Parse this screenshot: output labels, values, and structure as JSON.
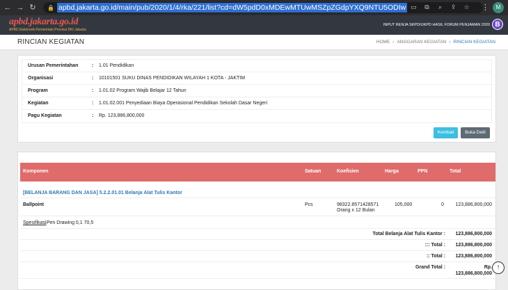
{
  "browser": {
    "url": "apbd.jakarta.go.id/main/pub/2020/1/4/rka/221/list?cd=dW5pdD0xMDEwMTUwMSZpZGdpYXQ9NTU5ODIw",
    "profile_initial": "M"
  },
  "header": {
    "logo": "apbd.jakarta.go.id",
    "logo_subtitle": "APBD Elektronik Pemerintah Provinsi DKI Jakarta",
    "right_text": "INPUT RENJA SKPD/UKPD HASIL FORUM PENJAMAN 2020",
    "badge": "B"
  },
  "page": {
    "title": "RINCIAN KEGIATAN",
    "breadcrumb": [
      "HOME",
      "ANGGARAN KEGIATAN",
      "RINCIAN KEGIATAN"
    ],
    "breadcrumb_sep": "›"
  },
  "info": {
    "rows": [
      {
        "label": "Urusan Pemerintahan",
        "value": "1.01 Pendidikan"
      },
      {
        "label": "Organisasi",
        "value": "10101501 SUKU DINAS PENDIDIKAN WILAYAH 1 KOTA - JAKTIM"
      },
      {
        "label": "Program",
        "value": "1.01.02 Program Wajib Belajar 12 Tahun"
      },
      {
        "label": "Kegiatan",
        "value": "1.01.02.001 Penyediaan Biaya Operasional Pendidikan Sekolah Dasar Negeri"
      },
      {
        "label": "Pagu Kegiatan",
        "value": "Rp. 123,886,800,000"
      }
    ],
    "colon": ":",
    "btn_kembali": "Kembali",
    "btn_detil": "Buka Detil"
  },
  "table": {
    "headers": {
      "komponen": "Komponen",
      "satuan": "Satuan",
      "koefisien": "Koefisien",
      "harga": "Harga",
      "ppn": "PPN",
      "total": "Total"
    },
    "group": "[BELANJA BARANG DAN JASA] 5.2.2.01.01 Belanja Alat Tulis Kantor",
    "item": {
      "komponen": "Ballpoint",
      "satuan": "Pcs",
      "koefisien_1": "98322.8571428571",
      "koefisien_2": "Orang x 12 Bulan",
      "harga": "105,000",
      "ppn": "0",
      "total": "123,886,800,000"
    },
    "spec_label": "Spesifikasi",
    "spec_value": ": Pen Drawing 0,1 70,5",
    "totals": [
      {
        "label": "Total Belanja Alat Tulis Kantor :",
        "value": "123,886,800,000"
      },
      {
        "label": "::: Total :",
        "value": "123,886,800,000"
      },
      {
        "label": ":: Total :",
        "value": "123,886,800,000"
      }
    ],
    "grand_label": "Grand Total :",
    "grand_value_1": "Rp.",
    "grand_value_2": "123,886,800,000"
  }
}
